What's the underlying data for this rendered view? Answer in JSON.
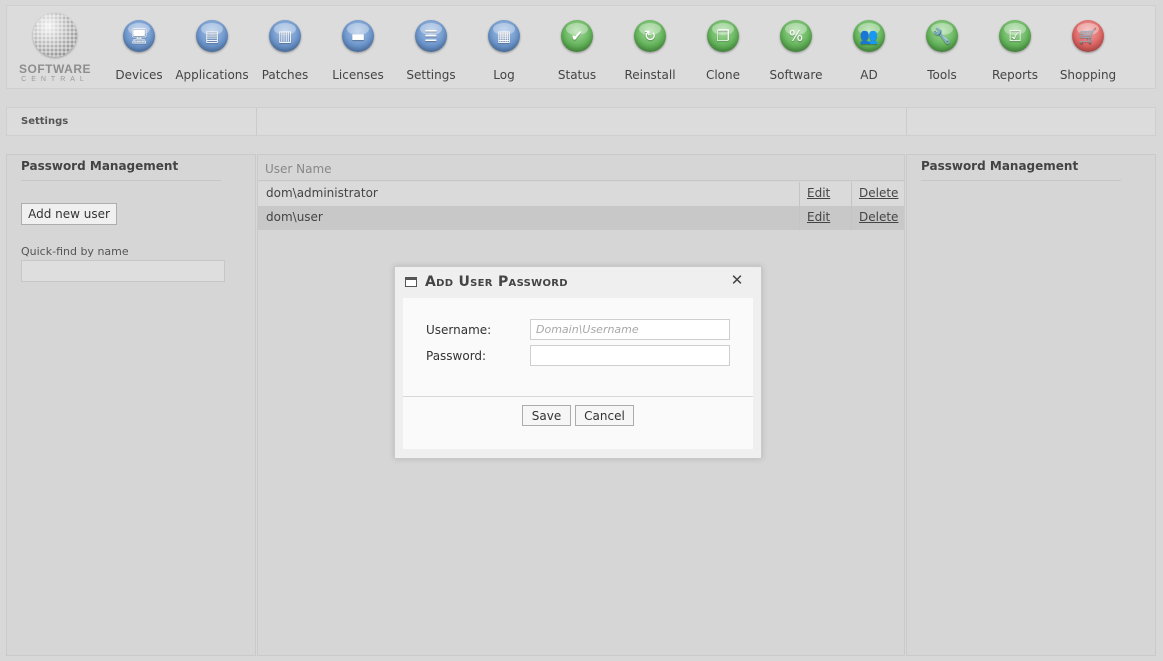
{
  "logo": {
    "text": "SOFTWARE",
    "subtext": "CENTRAL"
  },
  "nav": [
    {
      "label": "Devices",
      "icon": "monitor-icon",
      "glyph": "🖥",
      "color": "blue"
    },
    {
      "label": "Applications",
      "icon": "stack-icon",
      "glyph": "▤",
      "color": "blue"
    },
    {
      "label": "Patches",
      "icon": "book-icon",
      "glyph": "▥",
      "color": "blue"
    },
    {
      "label": "Licenses",
      "icon": "license-icon",
      "glyph": "▬",
      "color": "blue"
    },
    {
      "label": "Settings",
      "icon": "checklist-icon",
      "glyph": "☰",
      "color": "blue"
    },
    {
      "label": "Log",
      "icon": "open-book-icon",
      "glyph": "▦",
      "color": "blue"
    },
    {
      "label": "Status",
      "icon": "checkmark-icon",
      "glyph": "✔",
      "color": "green"
    },
    {
      "label": "Reinstall",
      "icon": "refresh-icon",
      "glyph": "↻",
      "color": "green"
    },
    {
      "label": "Clone",
      "icon": "copy-icon",
      "glyph": "❐",
      "color": "green"
    },
    {
      "label": "Software",
      "icon": "percent-icon",
      "glyph": "%",
      "color": "green"
    },
    {
      "label": "AD",
      "icon": "users-icon",
      "glyph": "👥",
      "color": "green"
    },
    {
      "label": "Tools",
      "icon": "wrench-icon",
      "glyph": "🔧",
      "color": "green"
    },
    {
      "label": "Reports",
      "icon": "report-check-icon",
      "glyph": "☑",
      "color": "green"
    },
    {
      "label": "Shopping",
      "icon": "cart-icon",
      "glyph": "🛒",
      "color": "red"
    }
  ],
  "breadcrumb": "Settings",
  "left_panel": {
    "title": "Password Management",
    "add_button": "Add new user",
    "quickfind_label": "Quick-find by name",
    "quickfind_value": ""
  },
  "table": {
    "header": "User Name",
    "rows": [
      {
        "name": "dom\\administrator",
        "edit": "Edit",
        "delete": "Delete"
      },
      {
        "name": "dom\\user",
        "edit": "Edit",
        "delete": "Delete"
      }
    ]
  },
  "right_panel": {
    "title": "Password Management"
  },
  "dialog": {
    "title": "Add User Password",
    "close": "✕",
    "username_label": "Username:",
    "username_placeholder": "Domain\\Username",
    "username_value": "",
    "password_label": "Password:",
    "password_value": "",
    "save": "Save",
    "cancel": "Cancel"
  }
}
